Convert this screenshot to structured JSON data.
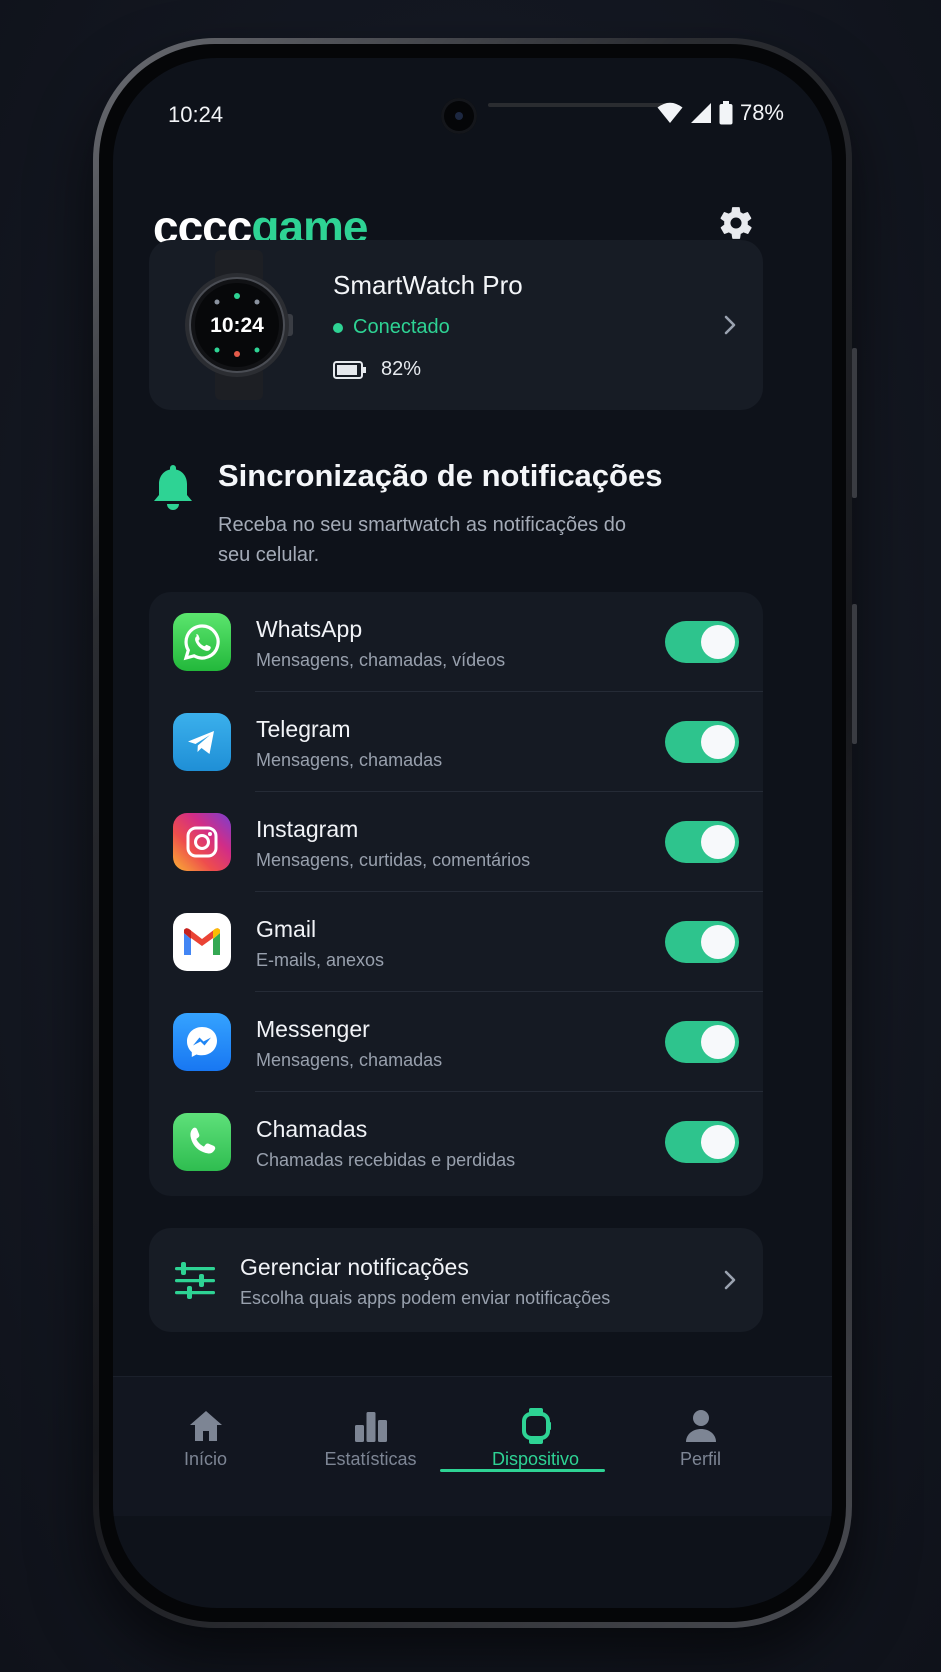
{
  "status_bar": {
    "time": "10:24",
    "battery": "78%"
  },
  "header": {
    "logo_part1": "cccc",
    "logo_part2": "game",
    "settings_icon": "gear-icon"
  },
  "device": {
    "watch_time": "10:24",
    "name": "SmartWatch Pro",
    "status": "Conectado",
    "battery": "82%"
  },
  "section": {
    "title": "Sincronização de notificações",
    "description": "Receba no seu smartwatch as notificações do seu celular."
  },
  "apps": [
    {
      "name": "WhatsApp",
      "sub": "Mensagens, chamadas, vídeos",
      "enabled": true,
      "icon": "whatsapp-icon"
    },
    {
      "name": "Telegram",
      "sub": "Mensagens, chamadas",
      "enabled": true,
      "icon": "telegram-icon"
    },
    {
      "name": "Instagram",
      "sub": "Mensagens, curtidas, comentários",
      "enabled": true,
      "icon": "instagram-icon"
    },
    {
      "name": "Gmail",
      "sub": "E-mails, anexos",
      "enabled": true,
      "icon": "gmail-icon"
    },
    {
      "name": "Messenger",
      "sub": "Mensagens, chamadas",
      "enabled": true,
      "icon": "messenger-icon"
    },
    {
      "name": "Chamadas",
      "sub": "Chamadas recebidas e perdidas",
      "enabled": true,
      "icon": "phone-icon"
    }
  ],
  "manage": {
    "title": "Gerenciar notificações",
    "sub": "Escolha quais apps podem enviar notificações"
  },
  "nav": [
    {
      "label": "Início",
      "icon": "home-icon",
      "active": false
    },
    {
      "label": "Estatísticas",
      "icon": "bar-chart-icon",
      "active": false
    },
    {
      "label": "Dispositivo",
      "icon": "watch-icon",
      "active": true
    },
    {
      "label": "Perfil",
      "icon": "person-icon",
      "active": false
    }
  ],
  "colors": {
    "accent": "#2ed394",
    "background": "#0e121a",
    "card": "#171c25"
  }
}
